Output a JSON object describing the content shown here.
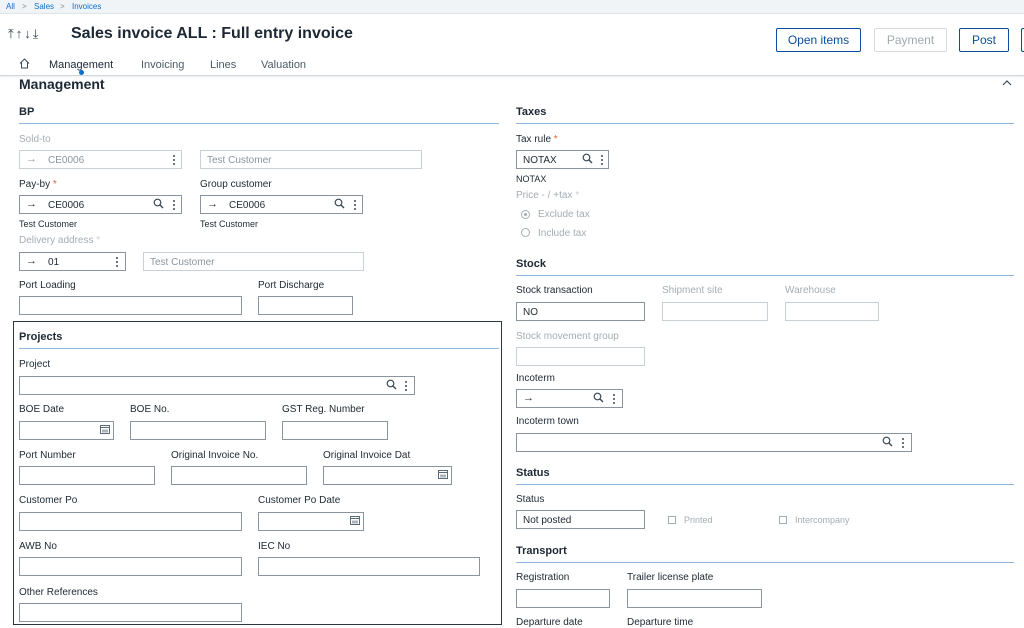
{
  "breadcrumb": {
    "all": "All",
    "sales": "Sales",
    "invoices": "Invoices"
  },
  "header": {
    "title": "Sales invoice ALL : Full entry invoice",
    "buttons": {
      "open_items": "Open items",
      "payment": "Payment",
      "post": "Post"
    }
  },
  "tabs": [
    "Management",
    "Invoicing",
    "Lines",
    "Valuation"
  ],
  "section": "Management",
  "bp": {
    "title": "BP",
    "sold_to": {
      "label": "Sold-to",
      "code": "CE0006",
      "name": "Test Customer"
    },
    "pay_by": {
      "label": "Pay-by",
      "code": "CE0006",
      "sub": "Test Customer"
    },
    "group_customer": {
      "label": "Group customer",
      "code": "CE0006",
      "sub": "Test Customer"
    },
    "delivery_address": {
      "label": "Delivery address",
      "code": "01",
      "name": "Test Customer"
    },
    "port_loading": {
      "label": "Port Loading",
      "value": ""
    },
    "port_discharge": {
      "label": "Port Discharge",
      "value": ""
    }
  },
  "projects": {
    "title": "Projects",
    "project": "Project",
    "boe_date": "BOE Date",
    "boe_no": "BOE No.",
    "gst_reg": "GST Reg. Number",
    "port_number": "Port Number",
    "original_invoice_no": "Original Invoice No.",
    "original_invoice_date": "Original Invoice Dat",
    "customer_po": "Customer Po",
    "customer_po_date": "Customer Po Date",
    "awb_no": "AWB No",
    "iec_no": "IEC No",
    "other_references": "Other References"
  },
  "taxes": {
    "title": "Taxes",
    "tax_rule": {
      "label": "Tax rule",
      "value": "NOTAX",
      "sub": "NOTAX"
    },
    "price_label": "Price - / +tax",
    "options": [
      "Exclude tax",
      "Include tax"
    ]
  },
  "stock": {
    "title": "Stock",
    "stock_transaction": {
      "label": "Stock transaction",
      "value": "NO"
    },
    "shipment_site": "Shipment site",
    "warehouse": "Warehouse",
    "movement_group": "Stock movement group",
    "incoterm": "Incoterm",
    "incoterm_town": "Incoterm town"
  },
  "status": {
    "title": "Status",
    "label": "Status",
    "value": "Not posted",
    "printed": "Printed",
    "intercompany": "Intercompany"
  },
  "transport": {
    "title": "Transport",
    "registration": "Registration",
    "trailer": "Trailer license plate",
    "departure_date": "Departure date",
    "departure_time": "Departure time"
  }
}
